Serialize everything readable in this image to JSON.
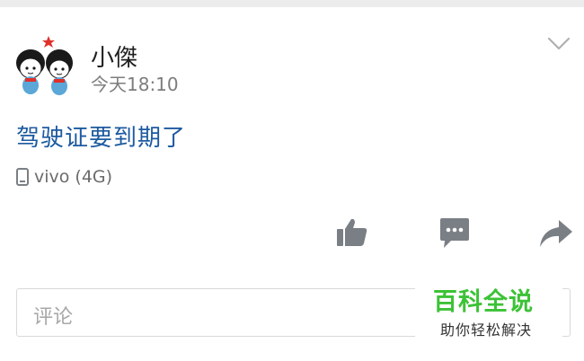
{
  "post": {
    "username": "小傑",
    "timestamp": "今天18:10",
    "content": "驾驶证要到期了",
    "device": "vivo (4G)",
    "device_icon": "phone-icon",
    "more_icon": "chevron-down-icon"
  },
  "actions": {
    "like_icon": "thumbs-up-icon",
    "comment_icon": "comment-bubble-icon",
    "share_icon": "share-arrow-icon"
  },
  "comment_box": {
    "placeholder": "评论"
  },
  "watermark": {
    "title": "百科全说",
    "subtitle": "助你轻松解决"
  },
  "colors": {
    "link_blue": "#1d5aa0",
    "icon_gray": "#7a7f85",
    "watermark_green": "#3cc236"
  }
}
